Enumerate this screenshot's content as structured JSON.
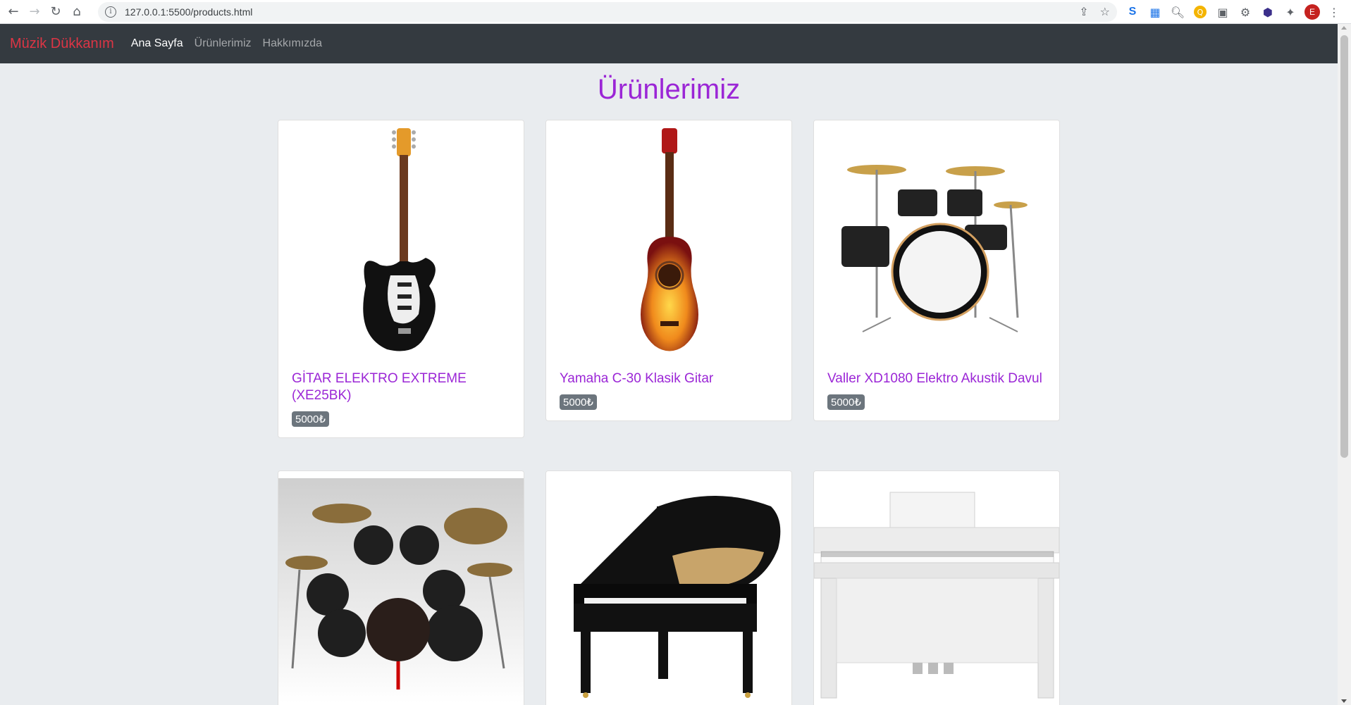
{
  "browser": {
    "url": "127.0.0.1:5500/products.html",
    "avatar_letter": "E",
    "ext_s_label": "S",
    "ext_yellow_label": "Q"
  },
  "navbar": {
    "brand": "Müzik Dükkanım",
    "links": [
      "Ana Sayfa",
      "Ürünlerimiz",
      "Hakkımızda"
    ],
    "brand_color": "#dc3545",
    "bg_color": "#343a40"
  },
  "page": {
    "title": "Ürünlerimiz",
    "accent_color": "#9b26d6"
  },
  "products": [
    {
      "name": "GİTAR ELEKTRO EXTREME (XE25BK)",
      "price": "5000₺",
      "image": "electric-guitar"
    },
    {
      "name": "Yamaha C-30 Klasik Gitar",
      "price": "5000₺",
      "image": "classical-guitar"
    },
    {
      "name": "Valler XD1080 Elektro Akustik Davul",
      "price": "5000₺",
      "image": "drum-kit"
    },
    {
      "name": "",
      "price": "",
      "image": "drum-kit-black"
    },
    {
      "name": "",
      "price": "",
      "image": "grand-piano"
    },
    {
      "name": "",
      "price": "",
      "image": "digital-piano-white"
    }
  ]
}
